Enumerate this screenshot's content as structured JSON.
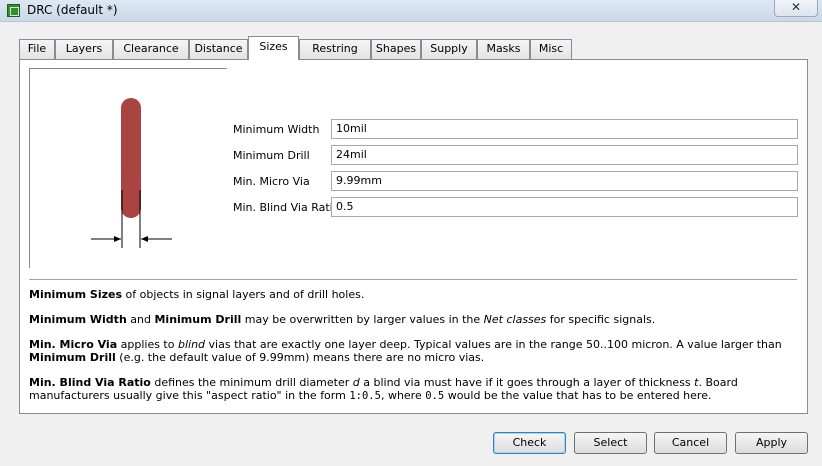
{
  "window": {
    "title": "DRC (default *)",
    "close_label": "✕",
    "icon": "app-board-icon"
  },
  "tabs": [
    {
      "label": "File"
    },
    {
      "label": "Layers"
    },
    {
      "label": "Clearance"
    },
    {
      "label": "Distance"
    },
    {
      "label": "Sizes",
      "active": true
    },
    {
      "label": "Restring"
    },
    {
      "label": "Shapes"
    },
    {
      "label": "Supply"
    },
    {
      "label": "Masks"
    },
    {
      "label": "Misc"
    }
  ],
  "fields": {
    "min_width": {
      "label": "Minimum Width",
      "value": "10mil"
    },
    "min_drill": {
      "label": "Minimum Drill",
      "value": "24mil"
    },
    "min_micro_via": {
      "label": "Min. Micro Via",
      "value": "9.99mm"
    },
    "min_blind_via_ratio": {
      "label": "Min. Blind Via Ratio",
      "value": "0.5"
    }
  },
  "help": {
    "p1": {
      "b1": "Minimum Sizes",
      "t1": " of objects in signal layers and of drill holes."
    },
    "p2": {
      "b1": "Minimum Width",
      "t1": " and ",
      "b2": "Minimum Drill",
      "t2": " may be overwritten by larger values in the ",
      "i1": "Net classes",
      "t3": " for specific signals."
    },
    "p3": {
      "b1": "Min. Micro Via",
      "t1": " applies to ",
      "i1": "blind",
      "t2": " vias that are exactly one layer deep. Typical values are in the range 50..100 micron. A value larger than ",
      "b2": "Minimum Drill",
      "t3": " (e.g. the default value of 9.99mm) means there are no micro vias."
    },
    "p4": {
      "b1": "Min. Blind Via Ratio",
      "t1": " defines the minimum drill diameter ",
      "i1": "d",
      "t2": " a blind via must have if it goes through a layer of thickness ",
      "i2": "t",
      "t3": ". Board manufacturers usually give this \"aspect ratio\" in the form ",
      "m1": "1:0.5",
      "t4": ", where ",
      "m2": "0.5",
      "t5": " would be the value that has to be entered here."
    }
  },
  "buttons": {
    "check": "Check",
    "select": "Select",
    "cancel": "Cancel",
    "apply": "Apply"
  },
  "colors": {
    "trace": "#a94442",
    "accent_default_button": "#3c7fb1"
  }
}
